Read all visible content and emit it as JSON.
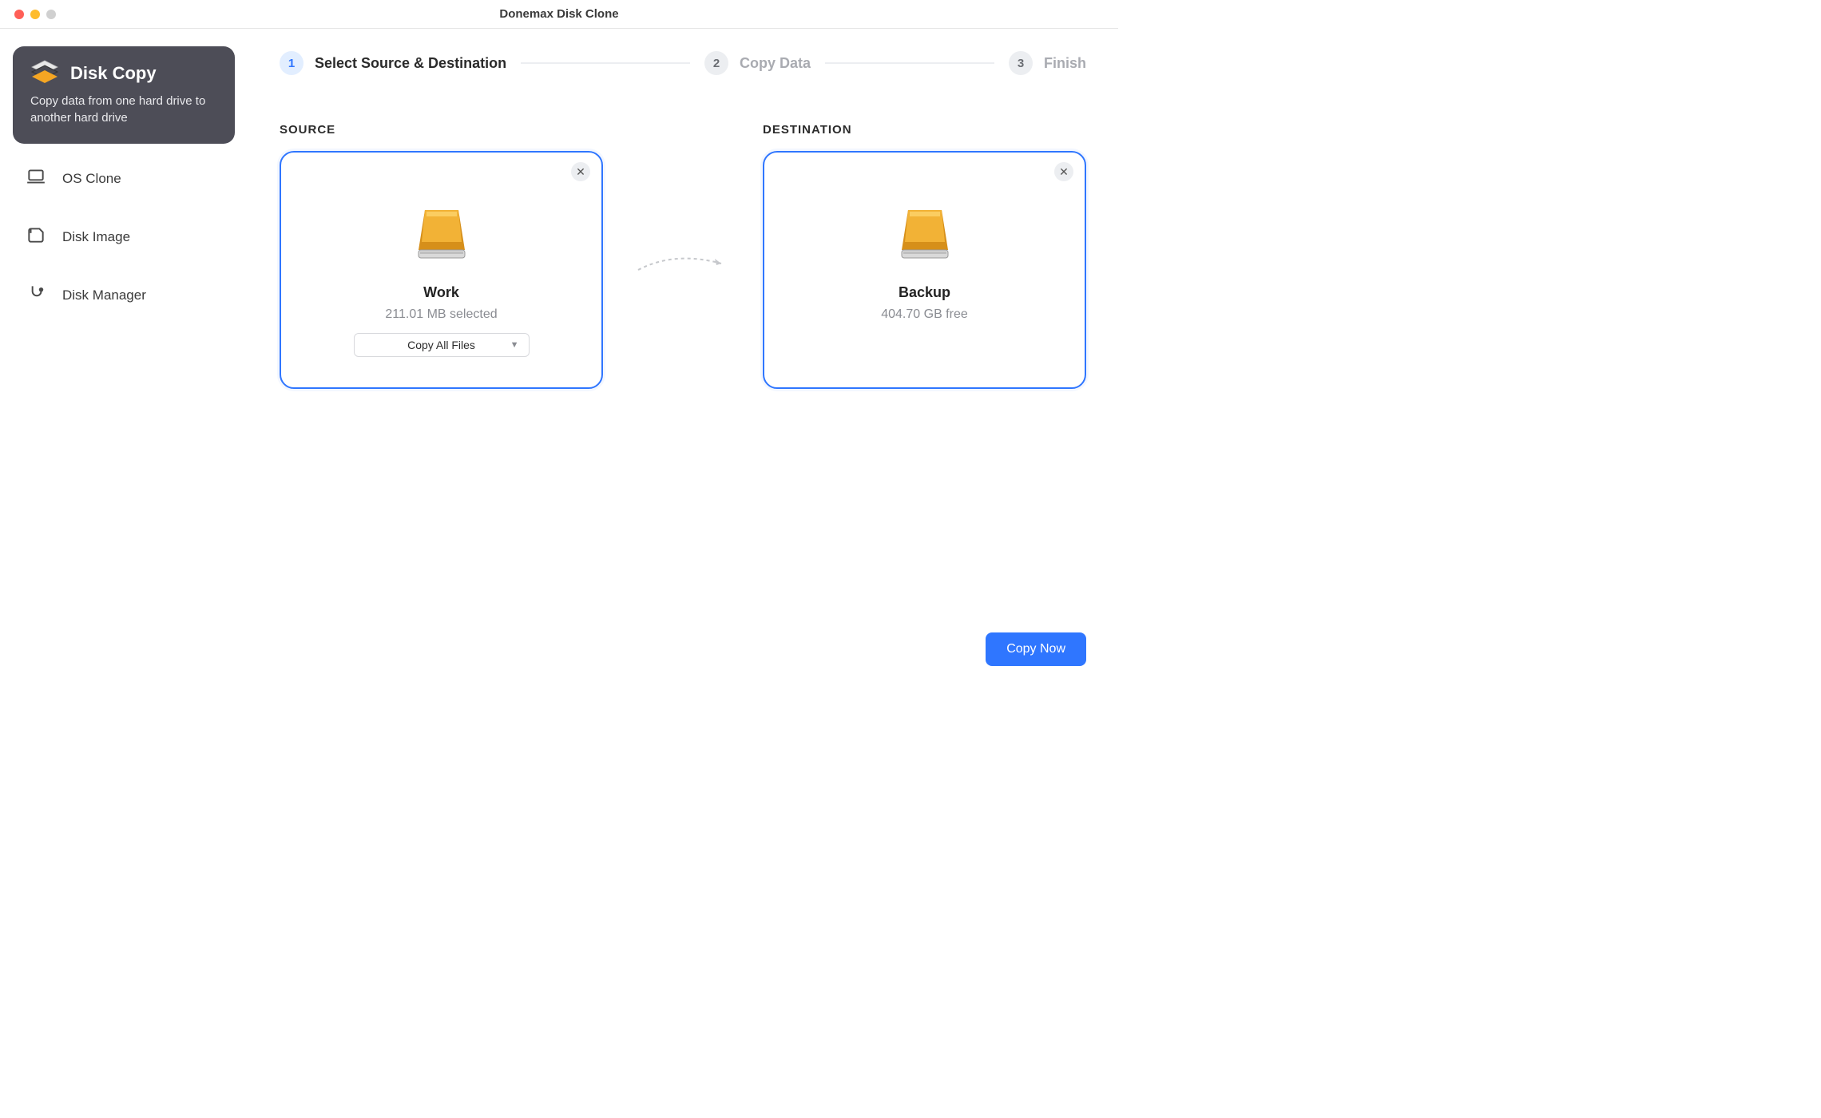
{
  "window": {
    "title": "Donemax Disk Clone"
  },
  "sidebar": {
    "active": {
      "title": "Disk Copy",
      "desc": "Copy data from one hard drive to another hard drive"
    },
    "items": [
      {
        "label": "OS Clone"
      },
      {
        "label": "Disk Image"
      },
      {
        "label": "Disk Manager"
      }
    ]
  },
  "stepper": {
    "steps": [
      {
        "num": "1",
        "label": "Select Source & Destination",
        "active": true
      },
      {
        "num": "2",
        "label": "Copy Data",
        "active": false
      },
      {
        "num": "3",
        "label": "Finish",
        "active": false
      }
    ]
  },
  "panels": {
    "source": {
      "heading": "SOURCE",
      "name": "Work",
      "subtitle": "211.01 MB selected",
      "select_value": "Copy All Files"
    },
    "destination": {
      "heading": "DESTINATION",
      "name": "Backup",
      "subtitle": "404.70 GB free"
    }
  },
  "actions": {
    "copy_now": "Copy Now"
  },
  "colors": {
    "accent": "#2f76ff"
  }
}
